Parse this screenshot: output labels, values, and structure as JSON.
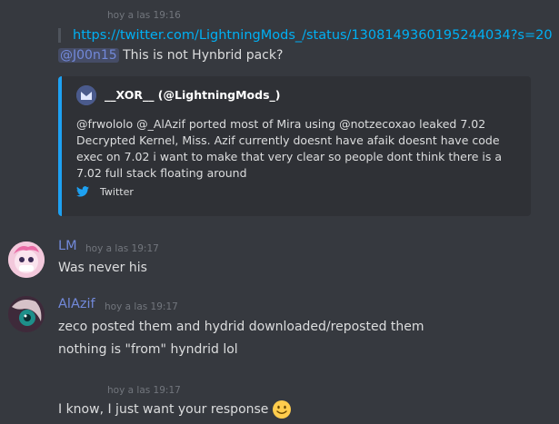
{
  "messages": {
    "m1": {
      "timestamp": "hoy a las 19:16",
      "link": "https://twitter.com/LightningMods_/status/1308149360195244034?s=20",
      "mention": "@J00n15",
      "text": " This is not Hynbrid pack?"
    },
    "embed": {
      "author": "__XOR__ (@LightningMods_)",
      "description": "@frwololo @_AlAzif ported most of Mira using @notzecoxao leaked 7.02 Decrypted Kernel, Miss. Azif currently doesnt have afaik doesnt have code exec on 7.02 i want to make that very clear so people dont think there is a 7.02 full stack floating around",
      "footer": "Twitter",
      "accent_color": "#1da1f2"
    },
    "lm": {
      "username": "LM",
      "timestamp": "hoy a las 19:17",
      "text": "Was never his"
    },
    "alazif": {
      "username": "AlAzif",
      "timestamp": "hoy a las 19:17",
      "text1": "zeco posted them and hydrid downloaded/reposted them",
      "text2": "nothing is \"from\" hyndrid lol"
    },
    "last": {
      "timestamp": "hoy a las 19:17",
      "text": "I know, I just want your response",
      "emoji": "slightly-smiling-face-icon"
    }
  },
  "colors": {
    "background": "#36393f",
    "link": "#00b0f4",
    "username": "#7289da"
  }
}
